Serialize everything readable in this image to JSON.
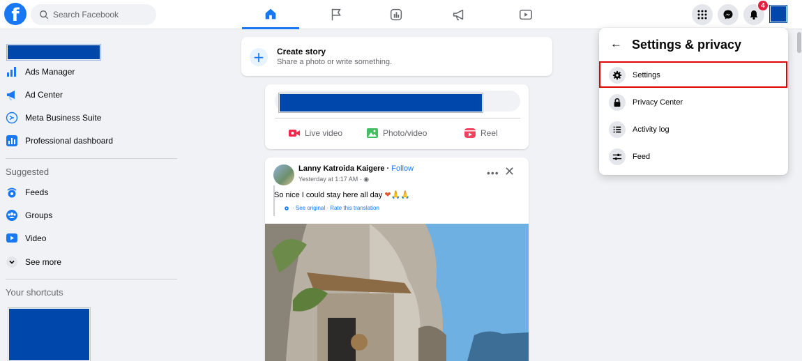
{
  "colors": {
    "brand": "#1877f2",
    "redacted": "#0047ab",
    "highlight": "#e00000",
    "badge": "#e41e3f"
  },
  "topbar": {
    "logo_icon": "facebook-logo",
    "logo_glyph": "f",
    "search_placeholder": "Search Facebook",
    "nav_tabs": [
      {
        "icon": "home-icon",
        "active": true
      },
      {
        "icon": "flag-icon",
        "active": false
      },
      {
        "icon": "marketplace-icon",
        "active": false
      },
      {
        "icon": "megaphone-icon",
        "active": false
      },
      {
        "icon": "video-icon",
        "active": false
      }
    ],
    "menu_icon": "grid-menu-icon",
    "messenger_icon": "messenger-icon",
    "notifications_icon": "bell-icon",
    "notifications_count": "4"
  },
  "sidebar": {
    "items": [
      {
        "label": "Ads Manager",
        "icon": "ads-manager-icon"
      },
      {
        "label": "Ad Center",
        "icon": "ad-center-icon"
      },
      {
        "label": "Meta Business Suite",
        "icon": "meta-business-icon"
      },
      {
        "label": "Professional dashboard",
        "icon": "dashboard-icon"
      }
    ],
    "suggested_title": "Suggested",
    "suggested": [
      {
        "label": "Feeds",
        "icon": "feeds-icon"
      },
      {
        "label": "Groups",
        "icon": "groups-icon"
      },
      {
        "label": "Video",
        "icon": "video-icon"
      },
      {
        "label": "See more",
        "icon": "chevron-down-icon"
      }
    ],
    "shortcuts_title": "Your shortcuts"
  },
  "create_story": {
    "title": "Create story",
    "subtitle": "Share a photo or write something.",
    "plus_glyph": "+"
  },
  "composer": {
    "buttons": [
      {
        "label": "Live video",
        "icon": "live-video-icon"
      },
      {
        "label": "Photo/video",
        "icon": "photo-icon"
      },
      {
        "label": "Reel",
        "icon": "reel-icon"
      }
    ]
  },
  "post": {
    "author": "Lanny Katroida Kaigere",
    "follow": "Follow",
    "separator": " · ",
    "time": "Yesterday at 1:17 AM · ",
    "text": "So nice I could stay here all day ",
    "emoji": "❤🙏🙏",
    "translation": "· See original · Rate this translation",
    "more_glyph": "•••",
    "close_glyph": "✕"
  },
  "settings_menu": {
    "back_glyph": "←",
    "title": "Settings & privacy",
    "items": [
      {
        "label": "Settings",
        "icon": "gear-icon",
        "highlighted": true
      },
      {
        "label": "Privacy Center",
        "icon": "lock-icon",
        "highlighted": false
      },
      {
        "label": "Activity log",
        "icon": "list-icon",
        "highlighted": false
      },
      {
        "label": "Feed",
        "icon": "sliders-icon",
        "highlighted": false
      }
    ]
  }
}
